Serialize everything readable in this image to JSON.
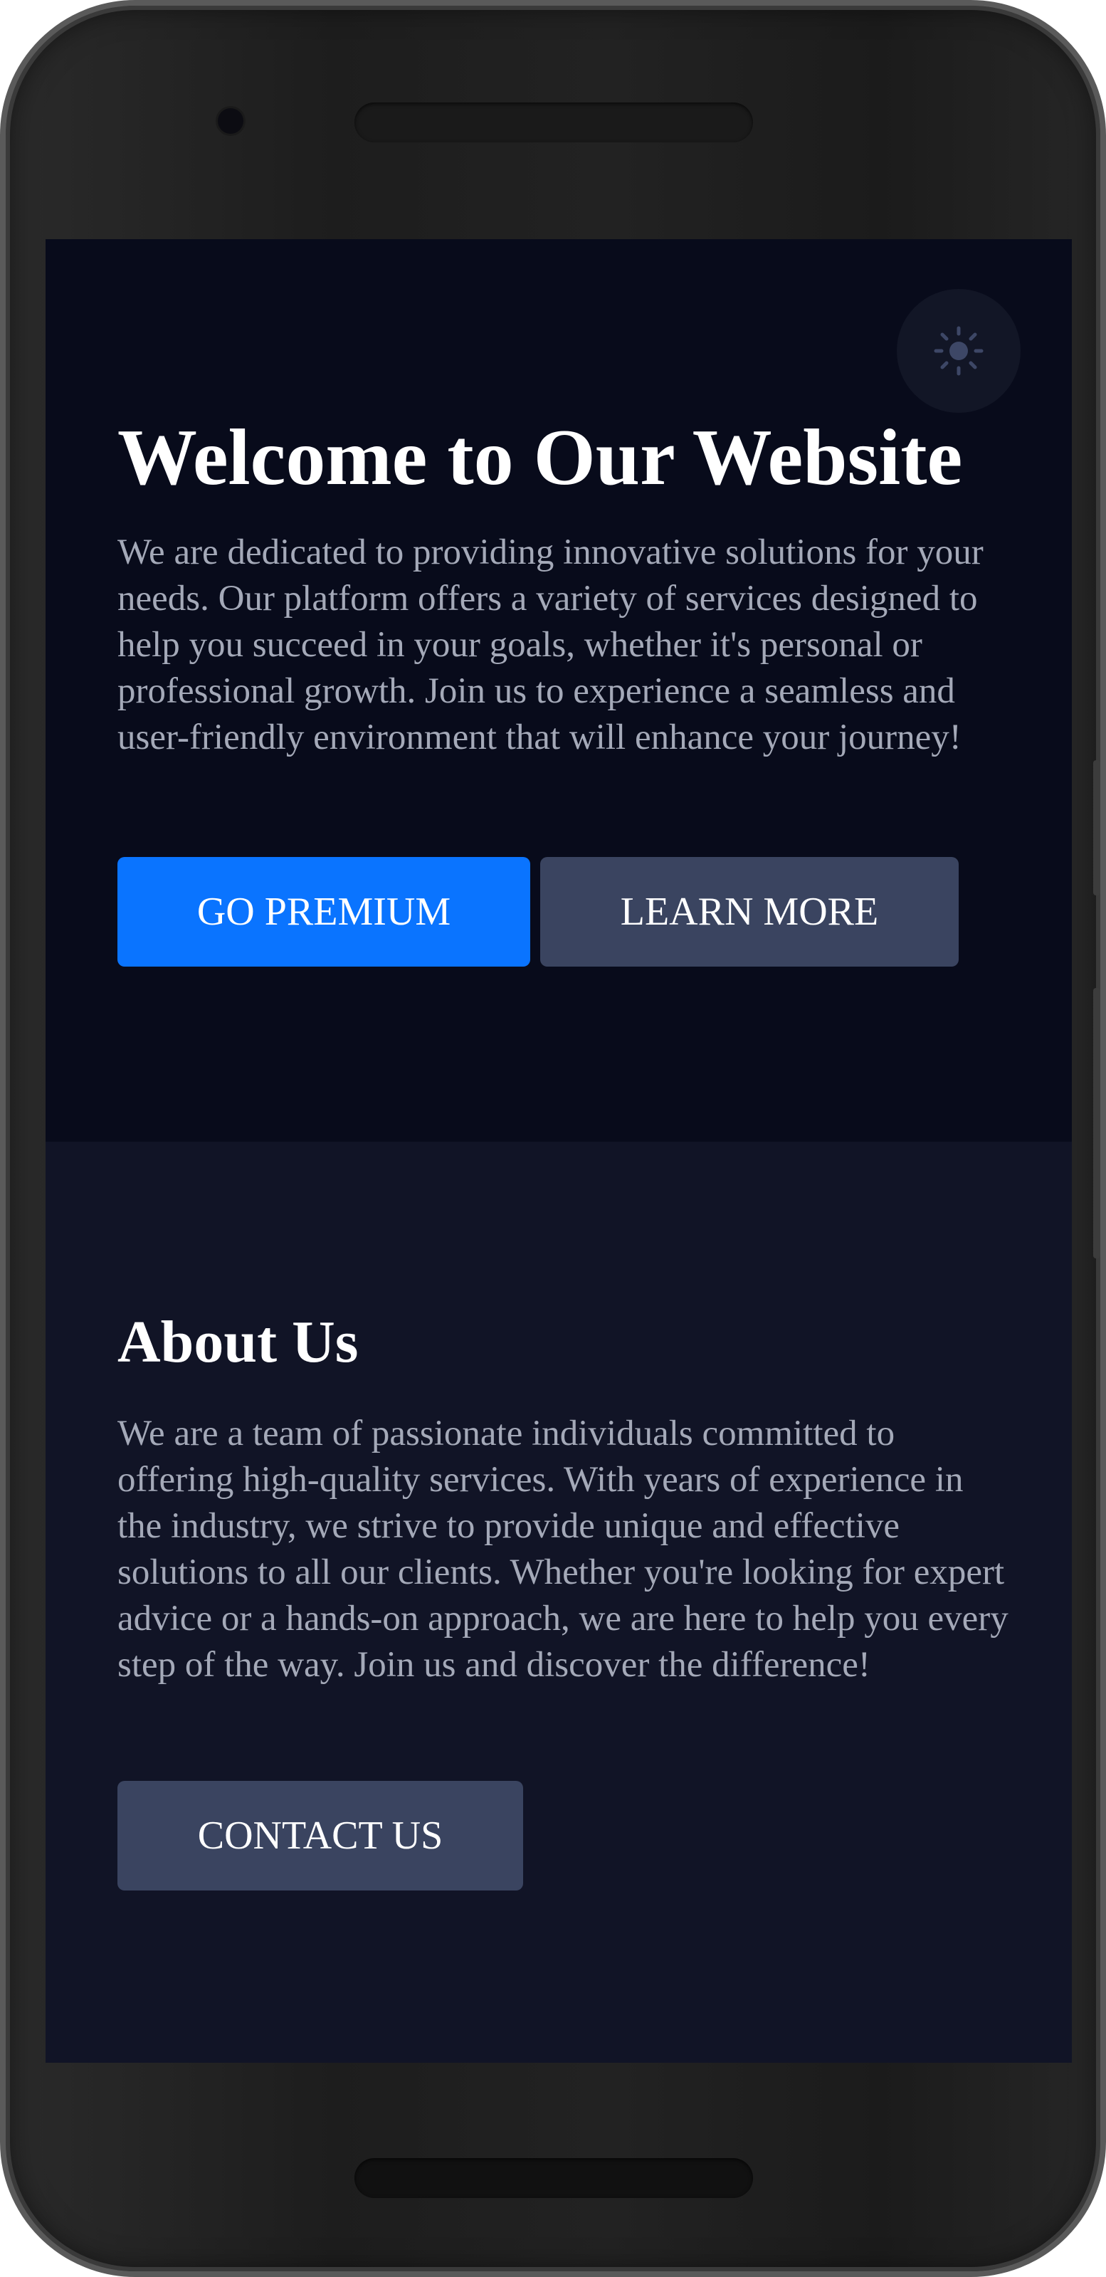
{
  "hero": {
    "title": "Welcome to Our Website",
    "description": "We are dedicated to providing innovative solutions for your needs. Our platform offers a variety of services designed to help you succeed in your goals, whether it's personal or professional growth. Join us to experience a seamless and user-friendly environment that will enhance your journey!",
    "primary_button": "GO PREMIUM",
    "secondary_button": "LEARN MORE",
    "theme_toggle_icon": "sun-icon"
  },
  "about": {
    "title": "About Us",
    "description": "We are a team of passionate individuals committed to offering high-quality services. With years of experience in the industry, we strive to provide unique and effective solutions to all our clients. Whether you're looking for expert advice or a hands-on approach, we are here to help you every step of the way. Join us and discover the difference!",
    "contact_button": "CONTACT US"
  },
  "colors": {
    "hero_background": "#080b1b",
    "about_background": "#111426",
    "primary_accent": "#0a74ff",
    "secondary_button": "#3a4460",
    "body_text": "#a4a9b8",
    "heading_text": "#ffffff"
  }
}
